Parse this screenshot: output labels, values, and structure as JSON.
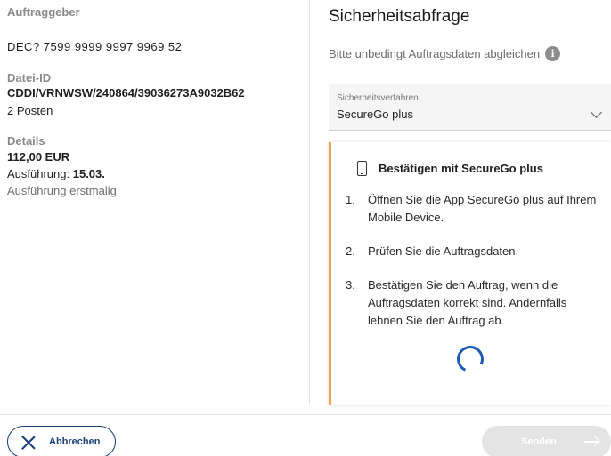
{
  "order": {
    "client_label": "Auftraggeber",
    "client_iban": "DEC? 7599 9999 9997 9969 52",
    "file_id_label": "Datei-ID",
    "file_id": "CDDI/VRNWSW/240864/39036273A9032B62",
    "items_count": "2 Posten",
    "details_label": "Details",
    "amount": "112,00 EUR",
    "execution_label": "Ausführung:",
    "execution_date": "15.03.",
    "execution_note": "Ausführung erstmalig"
  },
  "security": {
    "title": "Sicherheitsabfrage",
    "hint": "Bitte unbedingt Auftragsdaten abgleichen",
    "method_label": "Sicherheitsverfahren",
    "method_value": "SecureGo plus"
  },
  "panel": {
    "title": "Bestätigen mit SecureGo plus",
    "steps": [
      {
        "num": "1.",
        "text": "Öffnen Sie die App SecureGo plus auf Ihrem Mobile Device."
      },
      {
        "num": "2.",
        "text": "Prüfen Sie die Auftragsdaten."
      },
      {
        "num": "3.",
        "text": "Bestätigen Sie den Auftrag, wenn die Auftragsdaten korrekt sind. Andernfalls lehnen Sie den Auftrag ab."
      }
    ]
  },
  "actions": {
    "cancel_label": "Abbrechen",
    "send_label": "Senden"
  },
  "colors": {
    "accent_orange": "#f0a355",
    "primary_blue": "#1a3f7a",
    "spinner_blue": "#1a5bb8",
    "disabled_gray": "#e4e4e4"
  },
  "icons": {
    "info": "info-icon",
    "phone": "smartphone-icon",
    "close": "close-icon",
    "arrow": "arrow-right-icon",
    "chevron": "chevron-down-icon"
  }
}
